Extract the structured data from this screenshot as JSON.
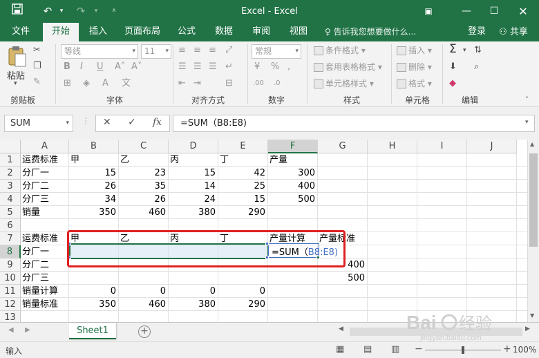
{
  "window": {
    "title": "Excel - Excel"
  },
  "quick_access": [
    "save-icon",
    "undo-icon",
    "redo-icon",
    "customize-icon"
  ],
  "ribbon_tabs": [
    "文件",
    "开始",
    "插入",
    "页面布局",
    "公式",
    "数据",
    "审阅",
    "视图"
  ],
  "active_tab": "开始",
  "tell_me": "告诉我您想要做什么...",
  "login": "登录",
  "share": "共享",
  "clipboard": {
    "paste": "粘贴",
    "label": "剪贴板"
  },
  "font": {
    "name": "等线",
    "size": "11",
    "label": "字体"
  },
  "alignment": {
    "label": "对齐方式"
  },
  "number": {
    "format": "常规",
    "label": "数字"
  },
  "styles": {
    "items": [
      "条件格式",
      "套用表格格式",
      "单元格样式"
    ],
    "label": "样式"
  },
  "cells_group": {
    "items": [
      "插入",
      "删除",
      "格式"
    ],
    "label": "单元格"
  },
  "editing": {
    "label": "编辑"
  },
  "formula_bar": {
    "name_box": "SUM",
    "formula": "=SUM（B8:E8)"
  },
  "columns": [
    "A",
    "B",
    "C",
    "D",
    "E",
    "F",
    "G",
    "H",
    "I",
    "J"
  ],
  "rows": [
    "1",
    "2",
    "3",
    "4",
    "5",
    "6",
    "7",
    "8",
    "9",
    "10",
    "11",
    "12",
    "13"
  ],
  "cells": {
    "A1": "运费标准",
    "B1": "甲",
    "C1": "乙",
    "D1": "丙",
    "E1": "丁",
    "F1": "产量",
    "A2": "分厂一",
    "B2": "15",
    "C2": "23",
    "D2": "15",
    "E2": "42",
    "F2": "300",
    "A3": "分厂二",
    "B3": "26",
    "C3": "35",
    "D3": "14",
    "E3": "25",
    "F3": "400",
    "A4": "分厂三",
    "B4": "34",
    "C4": "26",
    "D4": "24",
    "E4": "15",
    "F4": "500",
    "A5": "销量",
    "B5": "350",
    "C5": "460",
    "D5": "380",
    "E5": "290",
    "A7": "运费标准",
    "B7": "甲",
    "C7": "乙",
    "D7": "丙",
    "E7": "丁",
    "F7": "产量计算",
    "G7": "产量标准",
    "A8": "分厂一",
    "F8_prefix": "=SUM（",
    "F8_ref": "B8:E8)",
    "A9": "分厂二",
    "G9": "400",
    "A10": "分厂三",
    "G10": "500",
    "A11": "销量计算",
    "B11": "0",
    "C11": "0",
    "D11": "0",
    "E11": "0",
    "A12": "销量标准",
    "B12": "350",
    "C12": "460",
    "D12": "380",
    "E12": "290"
  },
  "sheet_tabs": [
    "Sheet1"
  ],
  "status": {
    "mode": "输入",
    "zoom": "100%"
  },
  "watermark": {
    "text": "Baidu经验",
    "sub": "jingyan.baidu.com"
  },
  "colors": {
    "excel_green": "#217346",
    "highlight_red": "#e02020",
    "ref_blue": "#4472c4"
  }
}
